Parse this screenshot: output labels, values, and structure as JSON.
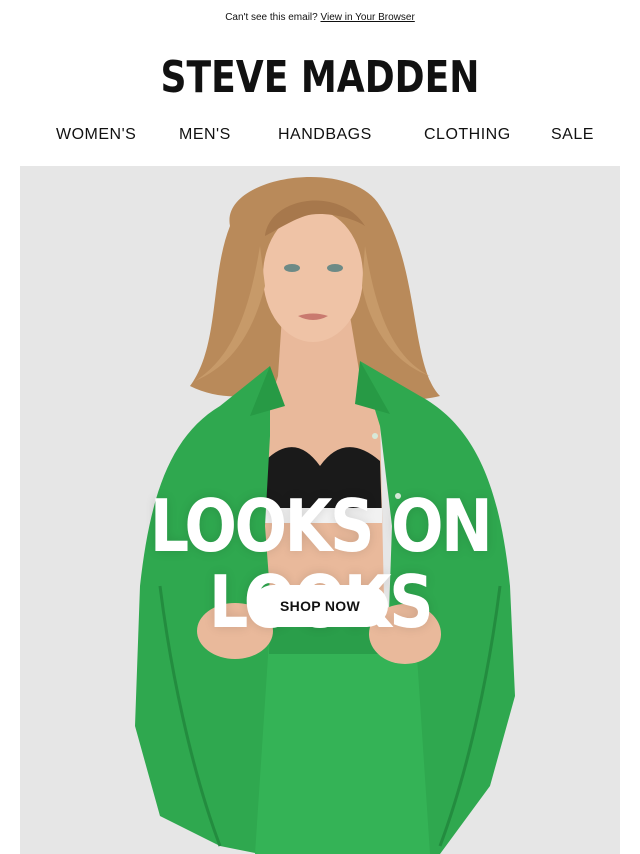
{
  "preheader": {
    "text": "Can't see this email?",
    "link_label": "View in Your Browser"
  },
  "brand": {
    "logo_text": "STEVE MADDEN"
  },
  "nav": {
    "items": [
      {
        "label": "WOMEN'S"
      },
      {
        "label": "MEN'S"
      },
      {
        "label": "HANDBAGS"
      },
      {
        "label": "CLOTHING"
      },
      {
        "label": "SALE"
      }
    ]
  },
  "hero": {
    "headline": "LOOKS ON LOOKS",
    "cta_label": "SHOP NOW",
    "image_subject": "model-in-green-shirt-and-shorts",
    "background_color": "#e6e6e6",
    "outfit_color": "#2fa84f"
  }
}
